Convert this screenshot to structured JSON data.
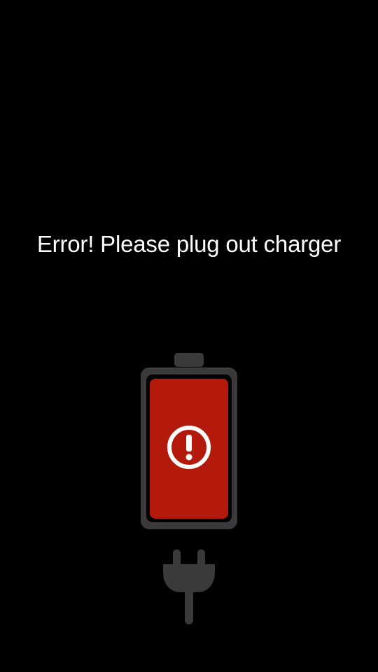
{
  "screen": {
    "message": "Error! Please plug out charger"
  },
  "icons": {
    "battery": "battery-icon",
    "alert": "exclamation-circle-icon",
    "plug": "charger-plug-icon"
  },
  "colors": {
    "background": "#000000",
    "text": "#ffffff",
    "battery_frame": "#3a3a3a",
    "battery_fill": "#b31a0b",
    "alert_icon": "#ffffff",
    "plug": "#3a3a3a"
  },
  "battery": {
    "state": "error"
  }
}
